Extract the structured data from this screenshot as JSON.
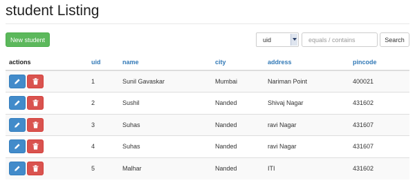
{
  "page": {
    "title": "student Listing"
  },
  "toolbar": {
    "new_label": "New student",
    "field_select_value": "uid",
    "filter_placeholder": "equals / contains",
    "filter_value": "",
    "search_label": "Search"
  },
  "table": {
    "headers": {
      "actions": "actions",
      "uid": "uid",
      "name": "name",
      "city": "city",
      "address": "address",
      "pincode": "pincode"
    },
    "rows": [
      {
        "uid": "1",
        "name": "Sunil Gavaskar",
        "city": "Mumbai",
        "address": "Nariman Point",
        "pincode": "400021"
      },
      {
        "uid": "2",
        "name": "Sushil",
        "city": "Nanded",
        "address": "Shivaj Nagar",
        "pincode": "431602"
      },
      {
        "uid": "3",
        "name": "Suhas",
        "city": "Nanded",
        "address": "ravi Nagar",
        "pincode": "431607"
      },
      {
        "uid": "4",
        "name": "Suhas",
        "city": "Nanded",
        "address": "ravi Nagar",
        "pincode": "431607"
      },
      {
        "uid": "5",
        "name": "Malhar",
        "city": "Nanded",
        "address": "ITI",
        "pincode": "431602"
      }
    ]
  },
  "icons": {
    "edit": "pencil-icon",
    "delete": "trash-icon",
    "select_arrow": "chevron-down-icon"
  },
  "colors": {
    "new_button": "#5cb85c",
    "edit_button": "#428bca",
    "delete_button": "#d9534f",
    "header_link": "#337ab7"
  }
}
